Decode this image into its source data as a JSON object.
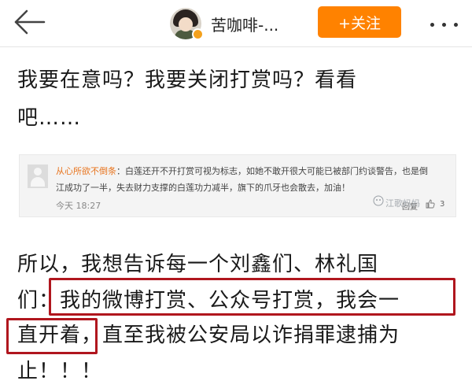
{
  "header": {
    "author_name": "苦咖啡-...",
    "follow_label": "+关注"
  },
  "post": {
    "paragraph1_line1": "我要在意吗？我要关闭打赏吗？看看",
    "paragraph1_line2": "吧……",
    "paragraph2_line1": "所以，我想告诉每一个刘鑫们、林礼国",
    "paragraph2_line2_pre": "们：",
    "paragraph2_line2_boxed": "我的微博打赏、公众号打赏，我会一",
    "paragraph2_line3_boxed": "直开着",
    "paragraph2_line3_rest": "，直至我被公安局以诈捐罪逮捕为",
    "paragraph2_line4": "止！！！"
  },
  "embedded_comment": {
    "commenter": "从心所欲不倒条",
    "line1_text": "：白莲还开不开打赏可视为标志，如她不敢开很大可能已被部门约谈警告，也是倒",
    "line2_text": "江成功了一半，失去财力支撑的白莲功力减半，旗下的爪牙也会散去，加油！",
    "time": "今天 18:27",
    "reply_label": "回复",
    "like_count": "3",
    "watermark": "江歌妈妈"
  },
  "colors": {
    "accent_orange": "#ff8200",
    "highlight_box": "#b0161e"
  },
  "icons": [
    "back-arrow-icon",
    "verified-badge-icon",
    "more-icon",
    "like-icon",
    "watermark-icon"
  ]
}
